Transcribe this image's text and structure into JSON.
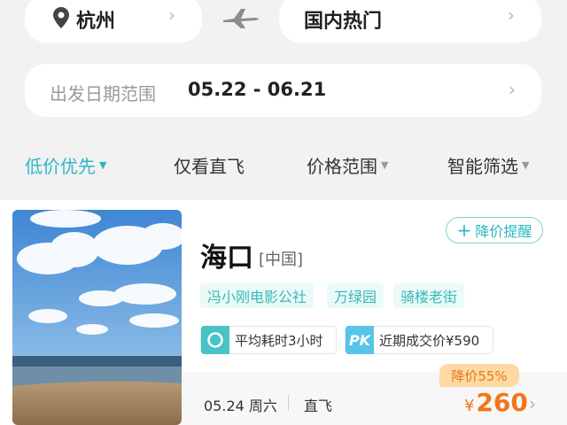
{
  "search": {
    "origin": "杭州",
    "destination": "国内热门",
    "date_label": "出发日期范围",
    "date_range": "05.22 - 06.21"
  },
  "filters": [
    {
      "label": "低价优先",
      "active": true,
      "has_dropdown": true
    },
    {
      "label": "仅看直飞",
      "active": false,
      "has_dropdown": false
    },
    {
      "label": "价格范围",
      "active": false,
      "has_dropdown": true
    },
    {
      "label": "智能筛选",
      "active": false,
      "has_dropdown": true
    }
  ],
  "result": {
    "city": "海口",
    "country": "[中国]",
    "remind_label": "降价提醒",
    "tags": [
      "冯小刚电影公社",
      "万绿园",
      "骑楼老街"
    ],
    "avg_time_label": "平均耗时3小时",
    "pk_label": "PK",
    "recent_price_label": "近期成交价¥590",
    "date": "05.24 周六",
    "flight_type": "直飞",
    "discount_badge": "降价55%",
    "price_symbol": "¥",
    "price": "260"
  },
  "colors": {
    "accent": "#2bb7c4",
    "price": "#f2751b",
    "badge_bg": "#ffd9a3"
  },
  "icons": {
    "origin": "location-pin-icon",
    "swap": "airplane-icon",
    "chevron": "chevron-right-icon",
    "remind": "plus-icon",
    "time": "clock-icon"
  }
}
